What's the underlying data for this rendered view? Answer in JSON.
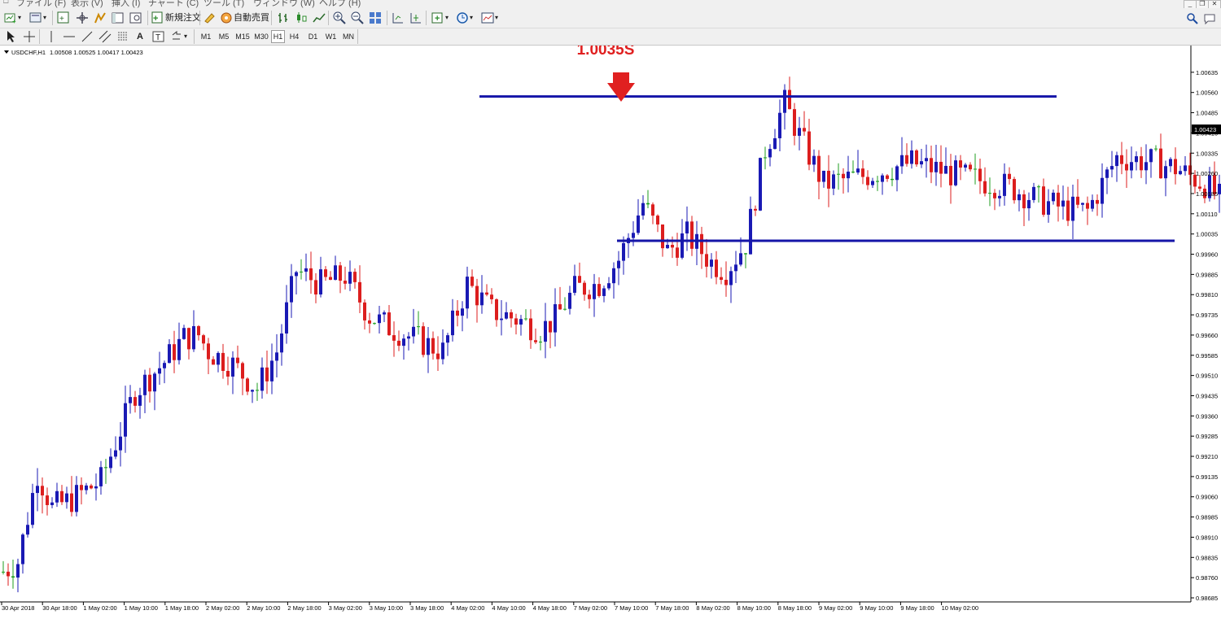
{
  "menu": {
    "items": [
      "ファイル (F)",
      "表示 (V)",
      "挿入 (I)",
      "チャート (C)",
      "ツール (T)",
      "ウィンドウ (W)",
      "ヘルプ (H)"
    ]
  },
  "toolbar": {
    "new_order_label": "新規注文",
    "auto_trade_label": "自動売買"
  },
  "timeframes": [
    "M1",
    "M5",
    "M15",
    "M30",
    "H1",
    "H4",
    "D1",
    "W1",
    "MN"
  ],
  "active_timeframe": "H1",
  "chart_header": {
    "symbol": "USDCHF,H1",
    "ohlc": "1.00508 1.00525 1.00417 1.00423"
  },
  "colors": {
    "bull": "#1a1ab4",
    "bear": "#dc1e1e",
    "doji": "#1f9e1f",
    "line": "#1515a8",
    "annotation": "#e02020"
  },
  "chart_data": {
    "type": "candlestick",
    "ylim": [
      0.98685,
      1.0071
    ],
    "price_labels": [
      "1.00635",
      "1.00560",
      "1.00485",
      "1.00410",
      "1.00335",
      "1.00260",
      "1.00185",
      "1.00110",
      "1.00035",
      "0.99960",
      "0.99885",
      "0.99810",
      "0.99735",
      "0.99660",
      "0.99585",
      "0.99510",
      "0.99435",
      "0.99360",
      "0.99285",
      "0.99210",
      "0.99135",
      "0.99060",
      "0.98985",
      "0.98910",
      "0.98835",
      "0.98760",
      "0.98685"
    ],
    "current_price": "1.00423",
    "time_labels": [
      "30 Apr 2018",
      "30 Apr 18:00",
      "1 May 02:00",
      "1 May 10:00",
      "1 May 18:00",
      "2 May 02:00",
      "2 May 10:00",
      "2 May 18:00",
      "3 May 02:00",
      "3 May 10:00",
      "3 May 18:00",
      "4 May 02:00",
      "4 May 10:00",
      "4 May 18:00",
      "7 May 02:00",
      "7 May 10:00",
      "7 May 18:00",
      "8 May 02:00",
      "8 May 10:00",
      "8 May 18:00",
      "9 May 02:00",
      "9 May 10:00",
      "9 May 18:00",
      "10 May 02:00"
    ],
    "resistance_level": 1.00545,
    "support_level": 1.0001,
    "annotation_text": "1.0035S",
    "anchors": [
      [
        0,
        0.9878
      ],
      [
        3,
        0.9882
      ],
      [
        7,
        0.9915
      ],
      [
        10,
        0.9902
      ],
      [
        14,
        0.9905
      ],
      [
        20,
        0.9912
      ],
      [
        27,
        0.9945
      ],
      [
        33,
        0.9956
      ],
      [
        37,
        0.9965
      ],
      [
        40,
        0.9966
      ],
      [
        42,
        0.996
      ],
      [
        47,
        0.9955
      ],
      [
        52,
        0.9946
      ],
      [
        56,
        0.996
      ],
      [
        60,
        0.999
      ],
      [
        65,
        0.9985
      ],
      [
        70,
        0.9988
      ],
      [
        75,
        0.9973
      ],
      [
        80,
        0.9968
      ],
      [
        85,
        0.9964
      ],
      [
        90,
        0.996
      ],
      [
        95,
        0.9985
      ],
      [
        100,
        0.9975
      ],
      [
        105,
        0.9972
      ],
      [
        110,
        0.9968
      ],
      [
        113,
        0.9972
      ],
      [
        117,
        0.9983
      ],
      [
        122,
        0.9985
      ],
      [
        126,
        0.9994
      ],
      [
        131,
        1.0015
      ],
      [
        136,
        0.9997
      ],
      [
        140,
        1.0003
      ],
      [
        145,
        0.9993
      ],
      [
        148,
        0.999
      ],
      [
        152,
        1.0
      ],
      [
        156,
        1.0035
      ],
      [
        160,
        1.0052
      ],
      [
        163,
        1.004
      ],
      [
        168,
        1.0022
      ],
      [
        176,
        1.0025
      ],
      [
        186,
        1.003
      ],
      [
        196,
        1.0025
      ],
      [
        206,
        1.0021
      ],
      [
        212,
        1.0016
      ],
      [
        217,
        1.0013
      ],
      [
        222,
        1.0012
      ],
      [
        228,
        1.0032
      ],
      [
        236,
        1.003
      ],
      [
        240,
        1.0028
      ],
      [
        246,
        1.0022
      ],
      [
        250,
        1.0015
      ],
      [
        254,
        1.0013
      ],
      [
        260,
        1.004
      ],
      [
        265,
        1.0045
      ],
      [
        269,
        1.0052
      ],
      [
        273,
        1.0048
      ],
      [
        277,
        1.0047
      ],
      [
        280,
        1.0042
      ]
    ]
  }
}
